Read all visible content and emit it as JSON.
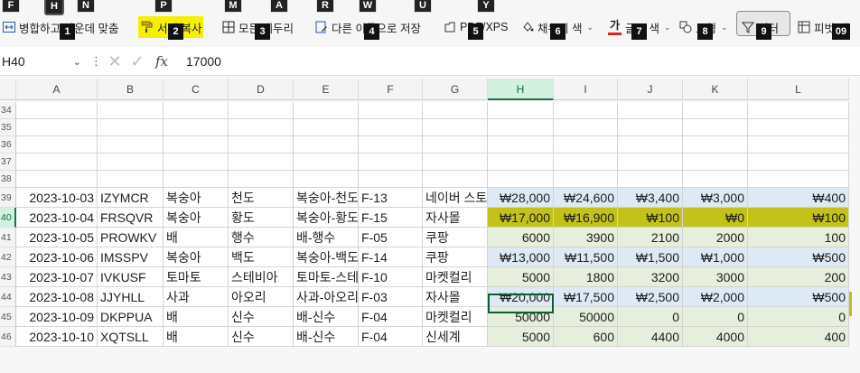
{
  "ribbon": {
    "tab_keys": [
      "F",
      "H",
      "N",
      "P",
      "M",
      "A",
      "R",
      "W",
      "U",
      "Y"
    ],
    "buttons": [
      {
        "label": "병합하고 가운데 맞춤",
        "icon": "merge-center-icon",
        "key": "1"
      },
      {
        "label": "서식 복사",
        "icon": "format-painter-icon",
        "key": "2"
      },
      {
        "label": "모든 테두리",
        "icon": "all-borders-icon",
        "key": "3"
      },
      {
        "label": "다른 이름으로 저장",
        "icon": "save-as-icon",
        "key": "4"
      },
      {
        "label": "PDF/XPS",
        "icon": "pdf-xps-icon",
        "key": "5"
      },
      {
        "label": "채우기 색",
        "icon": "fill-color-icon",
        "key": "6"
      },
      {
        "label": "글꼴 색",
        "icon": "font-color-icon",
        "icon_text": "가",
        "key": "7"
      },
      {
        "label": "도형",
        "icon": "shapes-icon",
        "key": "8"
      },
      {
        "label": "필터",
        "icon": "filter-icon",
        "key": "9"
      },
      {
        "label": "피벗 테",
        "icon": "pivot-table-icon",
        "key": "09"
      }
    ]
  },
  "formula_bar": {
    "name_box": "H40",
    "cancel_icon": "cancel-icon",
    "enter_icon": "check-icon",
    "fx_label": "fx",
    "value": "17000"
  },
  "columns": [
    "A",
    "B",
    "C",
    "D",
    "E",
    "F",
    "G",
    "H",
    "I",
    "J",
    "K",
    "L"
  ],
  "selected_column": "H",
  "selected_row": "40",
  "empty_rows": [
    "34",
    "35",
    "36",
    "37",
    "38"
  ],
  "rows": [
    {
      "row": "39",
      "cells": [
        "2023-10-03",
        "IZYMCR",
        "복숭아",
        "천도",
        "복숭아-천도",
        "F-13",
        "네이버 스토어",
        "₩28,000",
        "₩24,600",
        "₩3,400",
        "₩3,000",
        "₩400"
      ],
      "fill": "blue"
    },
    {
      "row": "40",
      "cells": [
        "2023-10-04",
        "FRSQVR",
        "복숭아",
        "황도",
        "복숭아-황도",
        "F-15",
        "자사몰",
        "₩17,000",
        "₩16,900",
        "₩100",
        "₩0",
        "₩100"
      ],
      "fill": "selected"
    },
    {
      "row": "41",
      "cells": [
        "2023-10-05",
        "PROWKV",
        "배",
        "행수",
        "배-행수",
        "F-05",
        "쿠팡",
        "6000",
        "3900",
        "2100",
        "2000",
        "100"
      ],
      "fill": "green"
    },
    {
      "row": "42",
      "cells": [
        "2023-10-06",
        "IMSSPV",
        "복숭아",
        "백도",
        "복숭아-백도",
        "F-14",
        "쿠팡",
        "₩13,000",
        "₩11,500",
        "₩1,500",
        "₩1,000",
        "₩500"
      ],
      "fill": "blue"
    },
    {
      "row": "43",
      "cells": [
        "2023-10-07",
        "IVKUSF",
        "토마토",
        "스테비아",
        "토마토-스테비아",
        "F-10",
        "마켓컬리",
        "5000",
        "1800",
        "3200",
        "3000",
        "200"
      ],
      "fill": "green"
    },
    {
      "row": "44",
      "cells": [
        "2023-10-08",
        "JJYHLL",
        "사과",
        "아오리",
        "사과-아오리",
        "F-03",
        "자사몰",
        "₩20,000",
        "₩17,500",
        "₩2,500",
        "₩2,000",
        "₩500"
      ],
      "fill": "blue"
    },
    {
      "row": "45",
      "cells": [
        "2023-10-09",
        "DKPPUA",
        "배",
        "신수",
        "배-신수",
        "F-04",
        "마켓컬리",
        "50000",
        "50000",
        "0",
        "0",
        "0"
      ],
      "fill": "green"
    },
    {
      "row": "46",
      "cells": [
        "2023-10-10",
        "XQTSLL",
        "배",
        "신수",
        "배-신수",
        "F-04",
        "신세계",
        "5000",
        "600",
        "4400",
        "4000",
        "400"
      ],
      "fill": "green"
    }
  ],
  "colors": {
    "selection_highlight": "#b9b80f",
    "blue_fill": "#dde9f5",
    "green_fill": "#e5efdb",
    "header_selected": "#d3f0e0",
    "keytip_yellow": "#f4f000"
  }
}
